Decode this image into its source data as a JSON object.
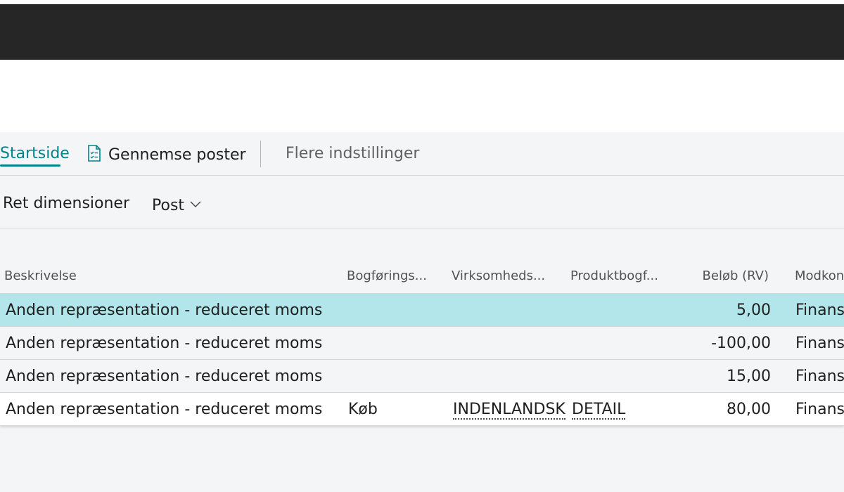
{
  "actionbar": {
    "tabs": [
      {
        "label": "Startside"
      },
      {
        "label": "Gennemse poster"
      },
      {
        "label": "Flere indstillinger"
      }
    ]
  },
  "subactions": {
    "edit_dimensions": "Ret dimensioner",
    "post_label": "Post"
  },
  "grid": {
    "headers": [
      "Beskrivelse",
      "Bogførings...",
      "Virksomheds...",
      "Produktbogf...",
      "Beløb (RV)",
      "Modkon"
    ],
    "rows": [
      {
        "description": "Anden repræsentation - reduceret moms",
        "posting": "",
        "business": "",
        "product": "",
        "amount": "5,00",
        "counter": "Finansl"
      },
      {
        "description": "Anden repræsentation - reduceret moms",
        "posting": "",
        "business": "",
        "product": "",
        "amount": "-100,00",
        "counter": "Finansl"
      },
      {
        "description": "Anden repræsentation - reduceret moms",
        "posting": "",
        "business": "",
        "product": "",
        "amount": "15,00",
        "counter": "Finansl"
      },
      {
        "description": "Anden repræsentation - reduceret moms",
        "posting": "Køb",
        "business": "INDENLANDSK",
        "product": "DETAIL",
        "amount": "80,00",
        "counter": "Finansl"
      }
    ]
  },
  "colors": {
    "accent": "#008489",
    "selected_row": "#b2e6ea",
    "top_bar": "#262626"
  }
}
